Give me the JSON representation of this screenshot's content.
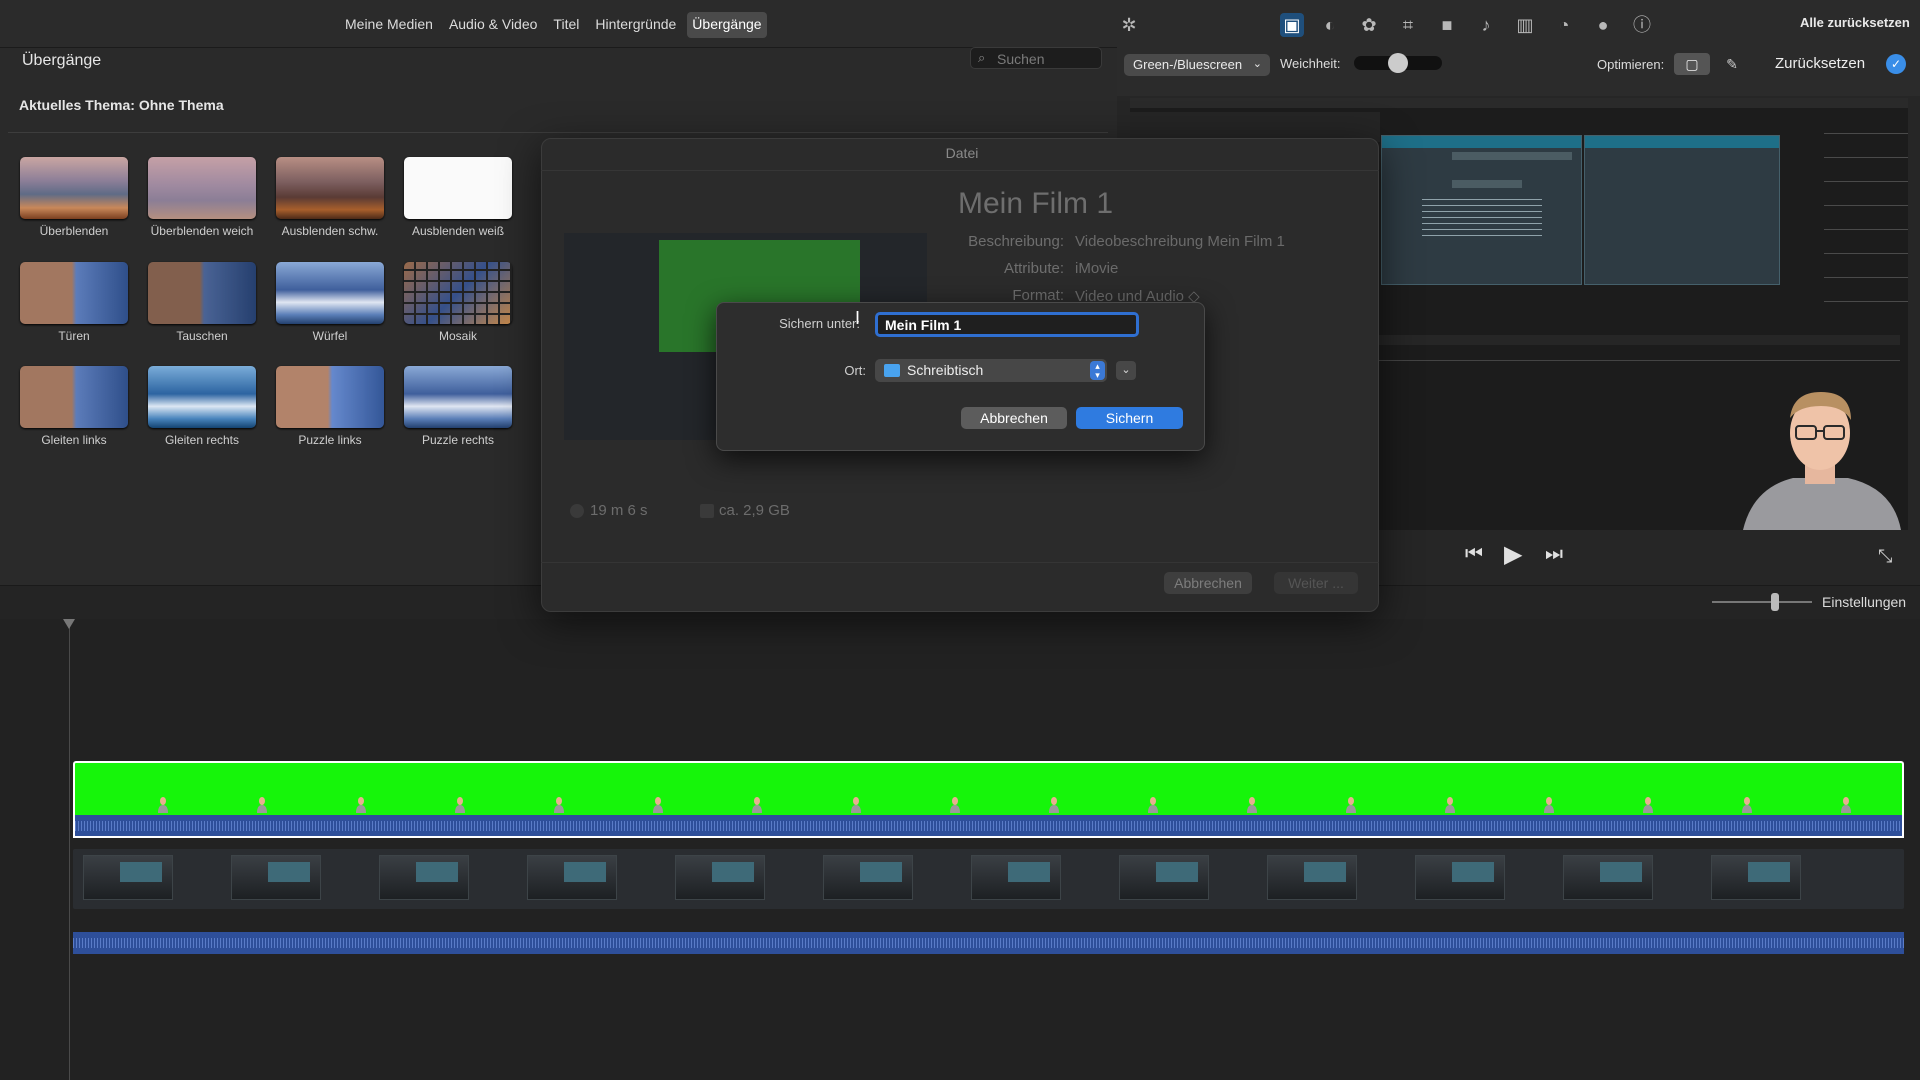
{
  "media_tabs": [
    {
      "label": "Meine Medien",
      "active": false
    },
    {
      "label": "Audio & Video",
      "active": false
    },
    {
      "label": "Titel",
      "active": false
    },
    {
      "label": "Hintergründe",
      "active": false
    },
    {
      "label": "Übergänge",
      "active": true
    }
  ],
  "browser": {
    "title": "Übergänge",
    "search_placeholder": "Suchen",
    "theme_label": "Aktuelles Thema: Ohne Thema",
    "transitions": [
      {
        "label": "Überblenden",
        "icon": "mountain-thumbnail"
      },
      {
        "label": "Überblenden weich",
        "icon": "mountain-soft-thumbnail"
      },
      {
        "label": "Ausblenden schw.",
        "icon": "mountain-dark-thumbnail"
      },
      {
        "label": "Ausblenden weiß",
        "icon": "white-thumbnail"
      },
      {
        "label": "Türen",
        "icon": "doors-thumbnail"
      },
      {
        "label": "Tauschen",
        "icon": "swap-thumbnail"
      },
      {
        "label": "Würfel",
        "icon": "cube-thumbnail"
      },
      {
        "label": "Mosaik",
        "icon": "mosaic-thumbnail"
      },
      {
        "label": "Gleiten links",
        "icon": "slide-left-thumbnail"
      },
      {
        "label": "Gleiten rechts",
        "icon": "slide-right-thumbnail"
      },
      {
        "label": "Puzzle links",
        "icon": "puzzle-left-thumbnail"
      },
      {
        "label": "Puzzle rechts",
        "icon": "puzzle-right-thumbnail"
      }
    ]
  },
  "viewer_toolbar": {
    "reset_all_label": "Alle zurücksetzen",
    "icons": [
      "magic-wand-icon",
      "video-overlay-icon",
      "color-balance-icon",
      "color-correction-icon",
      "crop-icon",
      "stabilization-icon",
      "volume-icon",
      "equalizer-icon",
      "speed-icon",
      "noise-reduction-icon",
      "info-icon"
    ],
    "keying_select": "Green-/Bluescreen",
    "softness_label": "Weichheit:",
    "optimize_label": "Optimieren:",
    "reset_label": "Zurücksetzen"
  },
  "timeline": {
    "settings_label": "Einstellungen"
  },
  "modal": {
    "title": "Datei",
    "film_name": "Mein Film 1",
    "fields": [
      {
        "label": "Beschreibung:",
        "value": "Videobeschreibung Mein Film 1"
      },
      {
        "label": "Attribute:",
        "value": "iMovie"
      },
      {
        "label": "Format:",
        "value": "Video und Audio ◇"
      }
    ],
    "duration": "19 m 6 s",
    "size": "ca. 2,9 GB",
    "cancel_label": "Abbrechen",
    "next_label": "Weiter ..."
  },
  "save_sheet": {
    "save_as_label": "Sichern unter:",
    "save_as_value": "Mein Film 1",
    "location_label": "Ort:",
    "location_value": "Schreibtisch",
    "cancel_label": "Abbrechen",
    "save_label": "Sichern"
  },
  "colors": {
    "accent": "#2f7be0",
    "greenscreen": "#16f50a",
    "audio": "#2e4f9a"
  }
}
